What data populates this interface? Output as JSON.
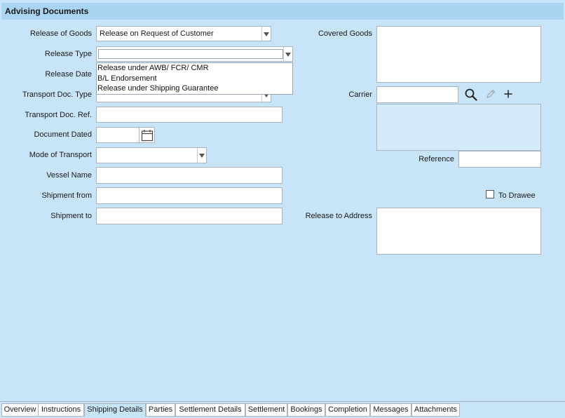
{
  "header": {
    "title": "Advising Documents"
  },
  "form": {
    "release_of_goods": {
      "label": "Release of Goods",
      "value": "Release on Request of Customer"
    },
    "release_type": {
      "label": "Release Type",
      "value": ""
    },
    "release_date": {
      "label": "Release Date"
    },
    "transport_doc_type": {
      "label": "Transport Doc. Type"
    },
    "transport_doc_ref": {
      "label": "Transport Doc. Ref.",
      "value": ""
    },
    "document_dated": {
      "label": "Document Dated",
      "value": ""
    },
    "mode_of_transport": {
      "label": "Mode of Transport",
      "value": ""
    },
    "vessel_name": {
      "label": "Vessel Name",
      "value": ""
    },
    "shipment_from": {
      "label": "Shipment from",
      "value": ""
    },
    "shipment_to": {
      "label": "Shipment to",
      "value": ""
    },
    "covered_goods": {
      "label": "Covered Goods",
      "value": ""
    },
    "carrier": {
      "label": "Carrier",
      "value": ""
    },
    "reference": {
      "label": "Reference",
      "value": ""
    },
    "to_drawee": {
      "label": "To Drawee",
      "checked": false
    },
    "release_to_address": {
      "label": "Release to Address",
      "value": ""
    }
  },
  "release_type_dropdown": {
    "options": [
      "Release under AWB/ FCR/ CMR",
      "B/L Endorsement",
      "Release under Shipping Guarantee"
    ]
  },
  "icons": {
    "calendar": "calendar-icon",
    "search": "search-icon",
    "edit": "pencil-icon",
    "add": "plus-icon"
  },
  "tabs": [
    {
      "label": "Overview",
      "active": false
    },
    {
      "label": "Instructions",
      "active": false
    },
    {
      "label": "Shipping Details",
      "active": true
    },
    {
      "label": "Parties",
      "active": false
    },
    {
      "label": "Settlement Details",
      "active": false
    },
    {
      "label": "Settlement",
      "active": false
    },
    {
      "label": "Bookings",
      "active": false
    },
    {
      "label": "Completion",
      "active": false
    },
    {
      "label": "Messages",
      "active": false
    },
    {
      "label": "Attachments",
      "active": false
    }
  ],
  "colors": {
    "background": "#c8e4f8",
    "header_bar": "#a9d5f2",
    "field_border": "#a7b5c2",
    "tinted_field": "#d4ebfa"
  }
}
